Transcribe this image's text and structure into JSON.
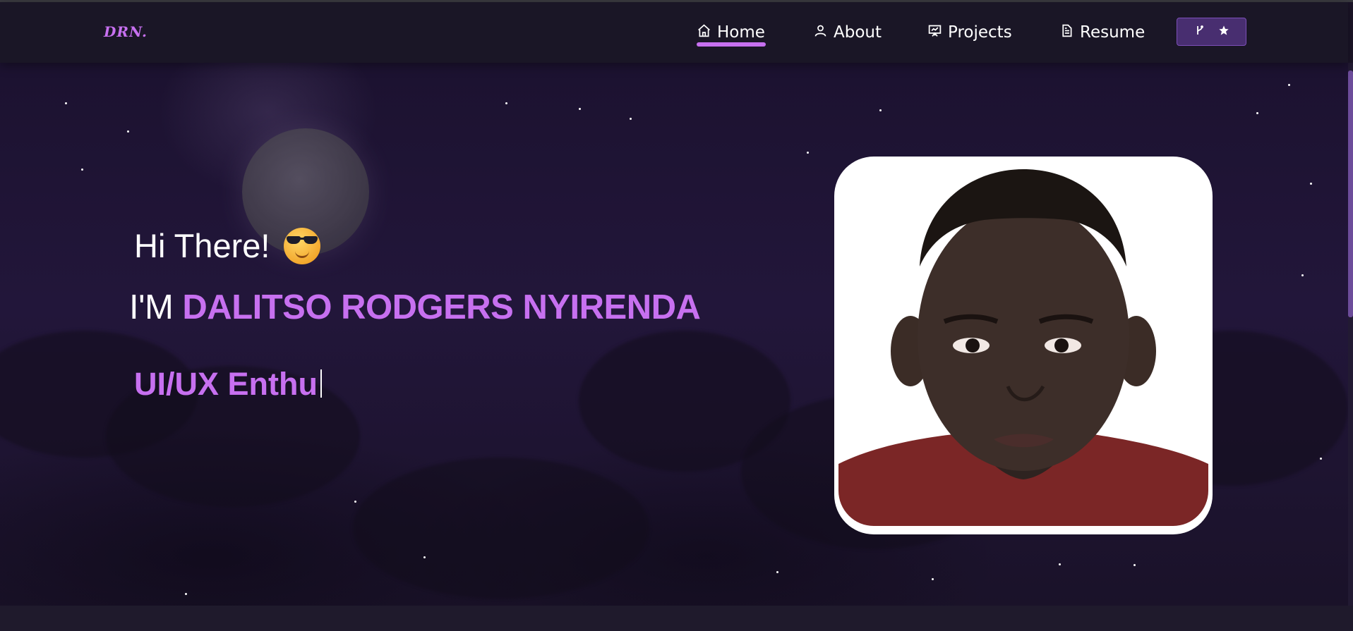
{
  "brand": {
    "logo": "DRN."
  },
  "nav": {
    "items": [
      {
        "label": "Home",
        "icon": "home-icon",
        "active": true
      },
      {
        "label": "About",
        "icon": "user-icon",
        "active": false
      },
      {
        "label": "Projects",
        "icon": "presentation-icon",
        "active": false
      },
      {
        "label": "Resume",
        "icon": "document-icon",
        "active": false
      }
    ],
    "repo_button": {
      "icons": [
        "git-fork-icon",
        "star-icon"
      ]
    }
  },
  "hero": {
    "greeting": "Hi There!",
    "greeting_emoji": "smiling-face-with-sunglasses-icon",
    "intro_prefix": "I'M",
    "name": "DALITSO RODGERS NYIRENDA",
    "typed_text": "UI/UX Enthu"
  },
  "colors": {
    "accent": "#c770f0",
    "navbar": "#1a1626",
    "background": "#22163a",
    "button": "#482e70"
  }
}
